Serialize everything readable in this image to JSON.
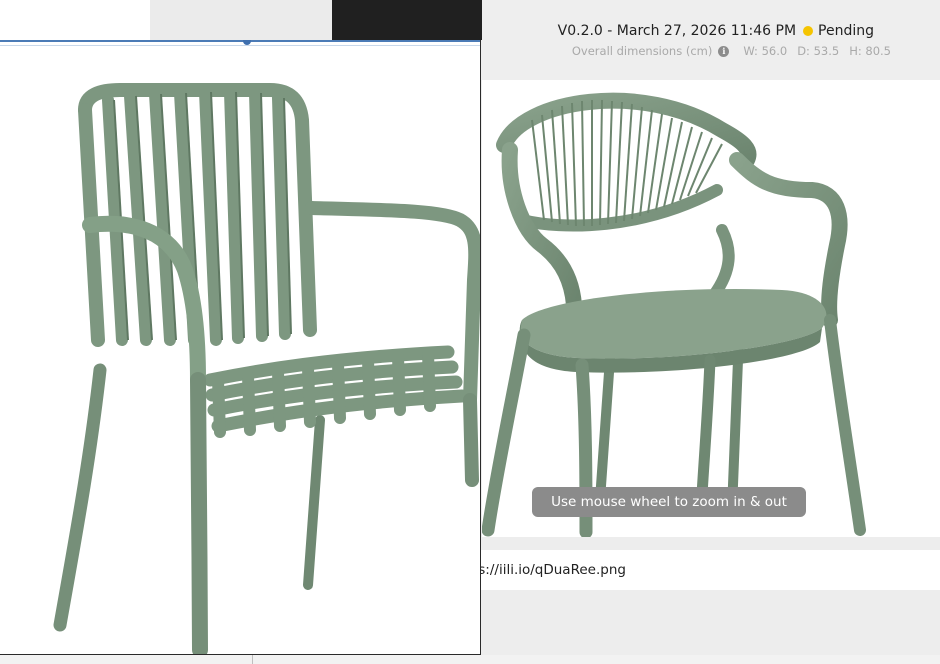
{
  "header": {
    "version": "V0.2.0 - March 27, 2026 11:46 PM",
    "status": "Pending",
    "status_color": "#f5c400",
    "dimensions_label": "Overall dimensions (cm)",
    "width": "W: 56.0",
    "depth": "D: 53.5",
    "height": "H: 80.5"
  },
  "viewer": {
    "zoom_hint": "Use mouse wheel to zoom in & out"
  },
  "url_bar": {
    "text": "os://iili.io/qDuaRee.png"
  },
  "colors": {
    "chair": "#7d9780",
    "chair_dark": "#5f7862",
    "chair_light": "#93ab95"
  }
}
